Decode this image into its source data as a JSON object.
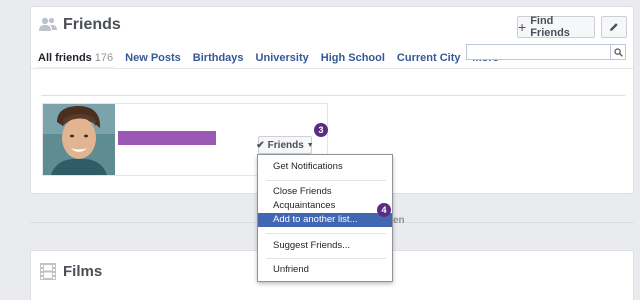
{
  "header": {
    "title": "Friends",
    "find_friends_label": "Find Friends",
    "edit_icon": "pencil-icon"
  },
  "tabs": [
    {
      "label": "All friends",
      "count": "176",
      "active": true
    },
    {
      "label": "New Posts"
    },
    {
      "label": "Birthdays"
    },
    {
      "label": "University"
    },
    {
      "label": "High School"
    },
    {
      "label": "Current City"
    },
    {
      "label": "More"
    }
  ],
  "search": {
    "placeholder": "",
    "icon": "search-icon"
  },
  "friend_card": {
    "friends_button_label": "Friends",
    "name_redacted_color": "#9b59b6"
  },
  "badges": {
    "friends_button": "3",
    "menu_item": "4"
  },
  "menu": {
    "items": [
      {
        "label": "Get Notifications"
      },
      {
        "label": "Close Friends"
      },
      {
        "label": "Acquaintances"
      },
      {
        "label": "Add to another list...",
        "selected": true
      },
      {
        "label": "Suggest Friends..."
      },
      {
        "label": "Unfriend"
      }
    ]
  },
  "behind_menu_text": "en",
  "films_section": {
    "title": "Films"
  },
  "colors": {
    "accent": "#4267b2",
    "link": "#365899",
    "badge": "#5b2d82"
  }
}
